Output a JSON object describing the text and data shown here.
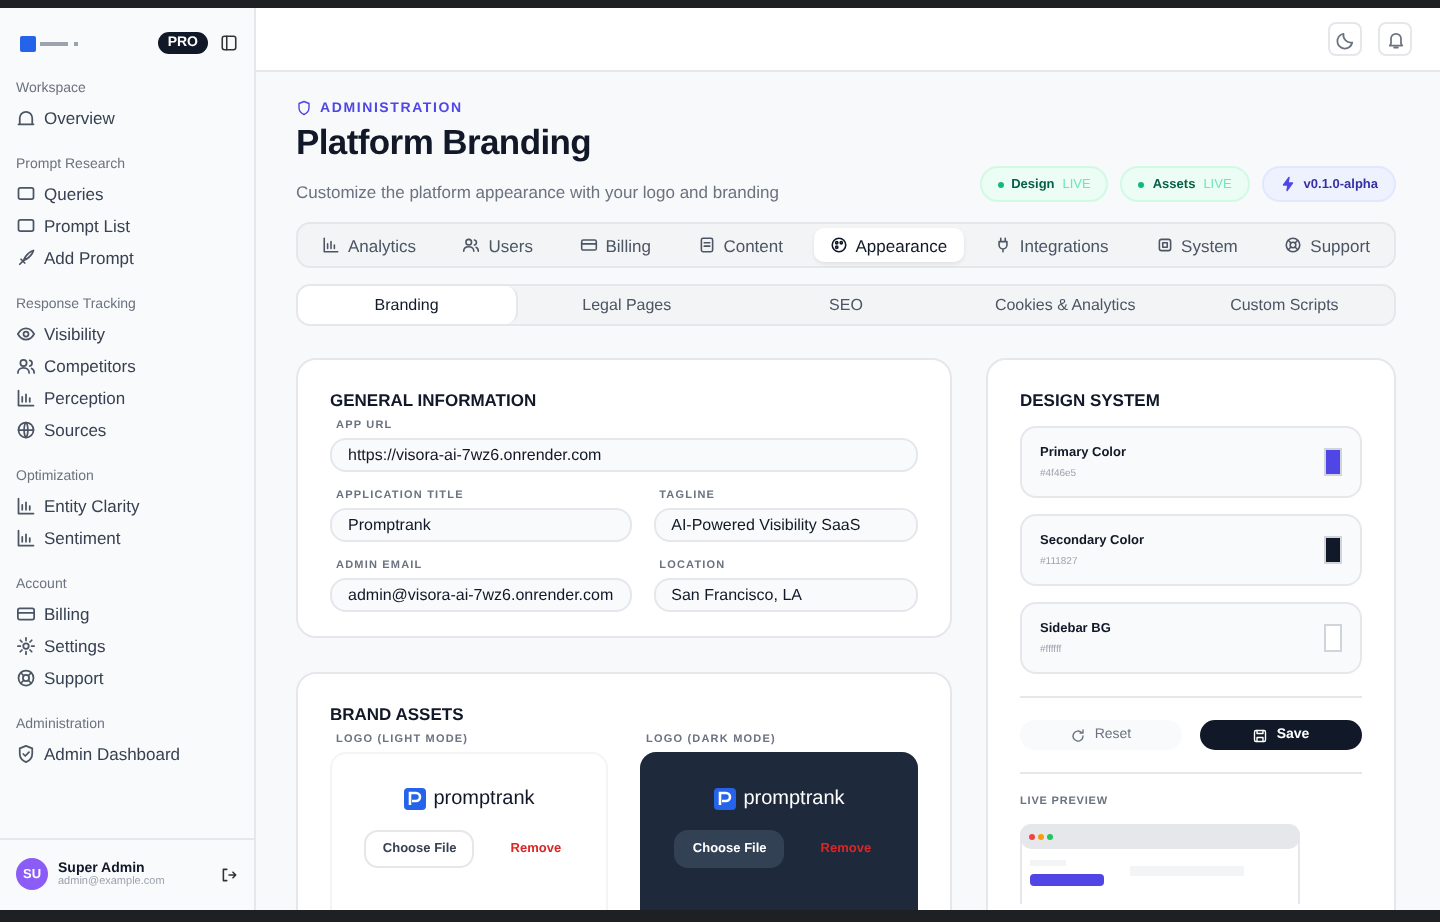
{
  "sidebar": {
    "plan_badge": "PRO",
    "sections": [
      {
        "title": "Workspace",
        "items": [
          "Overview"
        ]
      },
      {
        "title": "Prompt Research",
        "items": [
          "Queries",
          "Prompt List",
          "Add Prompt"
        ]
      },
      {
        "title": "Response Tracking",
        "items": [
          "Visibility",
          "Competitors",
          "Perception",
          "Sources"
        ]
      },
      {
        "title": "Optimization",
        "items": [
          "Entity Clarity",
          "Sentiment"
        ]
      },
      {
        "title": "Account",
        "items": [
          "Billing",
          "Settings",
          "Support"
        ]
      },
      {
        "title": "Administration",
        "items": [
          "Admin Dashboard"
        ]
      }
    ],
    "user": {
      "initials": "SU",
      "name": "Super Admin",
      "email": "admin@example.com"
    }
  },
  "page": {
    "eyebrow": "ADMINISTRATION",
    "title": "Platform Branding",
    "subtitle": "Customize the platform appearance with your logo and branding",
    "badges": [
      {
        "kind": "status",
        "label": "Design",
        "status": "LIVE"
      },
      {
        "kind": "status",
        "label": "Assets",
        "status": "LIVE"
      },
      {
        "kind": "version",
        "label": "v0.1.0-alpha"
      }
    ]
  },
  "tabs": [
    {
      "label": "Analytics",
      "selected": false
    },
    {
      "label": "Users",
      "selected": false
    },
    {
      "label": "Billing",
      "selected": false
    },
    {
      "label": "Content",
      "selected": false
    },
    {
      "label": "Appearance",
      "selected": true
    },
    {
      "label": "Integrations",
      "selected": false
    },
    {
      "label": "System",
      "selected": false
    },
    {
      "label": "Support",
      "selected": false
    }
  ],
  "subtabs": [
    {
      "label": "Branding",
      "selected": true
    },
    {
      "label": "Legal Pages",
      "selected": false
    },
    {
      "label": "SEO",
      "selected": false
    },
    {
      "label": "Cookies & Analytics",
      "selected": false
    },
    {
      "label": "Custom Scripts",
      "selected": false
    }
  ],
  "general": {
    "title": "GENERAL INFORMATION",
    "fields": [
      {
        "label": "APP URL",
        "value": "https://visora-ai-7wz6.onrender.com"
      },
      {
        "label": "APPLICATION TITLE",
        "value": "Promptrank"
      },
      {
        "label": "TAGLINE",
        "value": "AI-Powered Visibility SaaS"
      },
      {
        "label": "ADMIN EMAIL",
        "value": "admin@visora-ai-7wz6.onrender.com"
      },
      {
        "label": "LOCATION",
        "value": "San Francisco, LA"
      }
    ]
  },
  "assets": {
    "title": "BRAND ASSETS",
    "logos": [
      {
        "kind": "light",
        "label": "LOGO (LIGHT MODE)",
        "logo_text": "promptrank",
        "choose": "Choose File",
        "remove": "Remove"
      },
      {
        "kind": "dark",
        "label": "LOGO (DARK MODE)",
        "logo_text": "promptrank",
        "choose": "Choose File",
        "remove": "Remove"
      }
    ]
  },
  "design": {
    "title": "DESIGN SYSTEM",
    "colors": [
      {
        "name": "Primary Color",
        "value": "#4f46e5",
        "color": "#4f46e5"
      },
      {
        "name": "Secondary Color",
        "value": "#111827",
        "color": "#111827"
      },
      {
        "name": "Sidebar BG",
        "value": "#ffffff",
        "color": "#ffffff"
      }
    ],
    "reset": "Reset",
    "save": "Save",
    "preview_label": "LIVE PREVIEW"
  }
}
